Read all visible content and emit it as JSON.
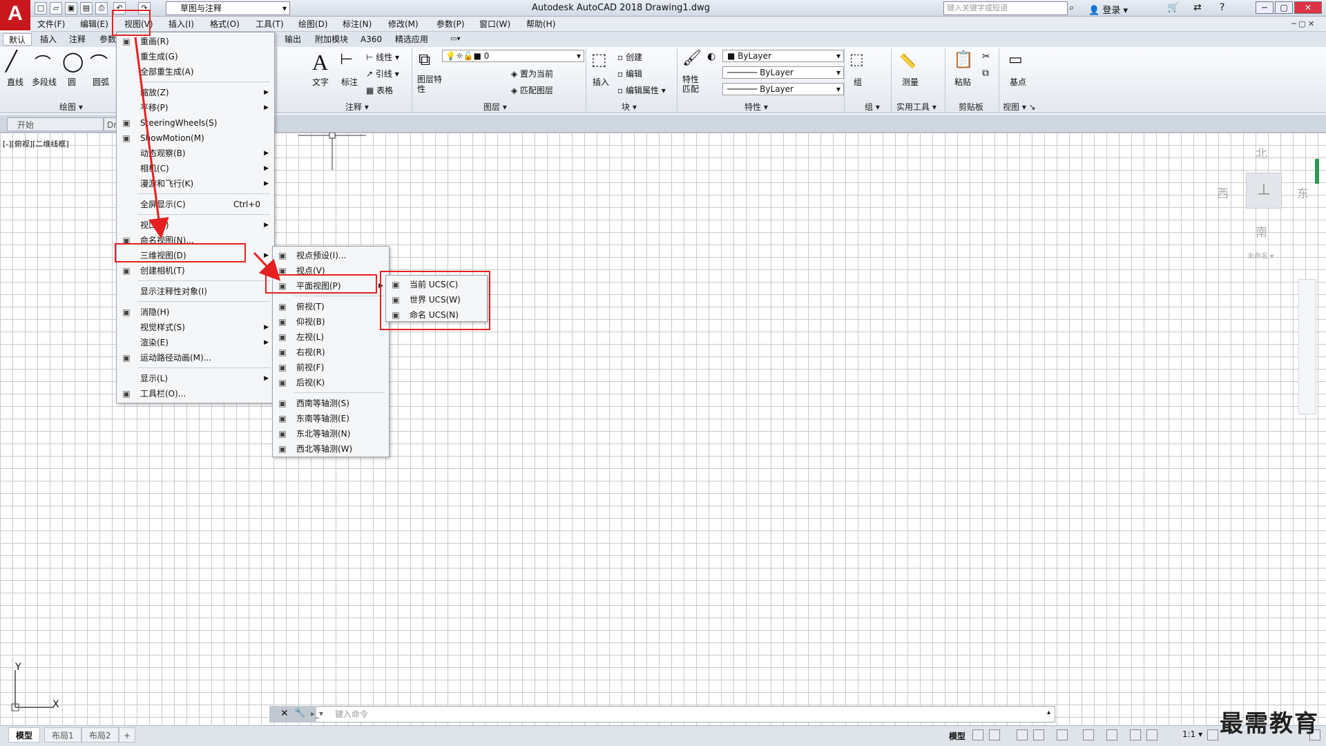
{
  "app_title": "Autodesk AutoCAD 2018    Drawing1.dwg",
  "workspace": "草图与注释",
  "search_placeholder": "键入关键字或短语",
  "login": "登录",
  "menubar": [
    "文件(F)",
    "编辑(E)",
    "视图(V)",
    "插入(I)",
    "格式(O)",
    "工具(T)",
    "绘图(D)",
    "标注(N)",
    "修改(M)",
    "参数(P)",
    "窗口(W)",
    "帮助(H)"
  ],
  "ribbon_tabs": [
    "默认",
    "插入",
    "注释",
    "参数",
    "输出",
    "附加模块",
    "A360",
    "精选应用"
  ],
  "ribbon": {
    "draw_buttons": [
      "直线",
      "多段线",
      "圆",
      "圆弧"
    ],
    "draw_panel": "绘图",
    "annot_buttons": [
      "文字",
      "标注"
    ],
    "annot_small": [
      "线性",
      "引线",
      "表格"
    ],
    "annot_panel": "注释",
    "layer_btn": "图层特性",
    "layer_value": "0",
    "layer_small": [
      "置为当前",
      "匹配图层"
    ],
    "layer_panel": "图层",
    "block_btn": "插入",
    "block_small": [
      "创建",
      "编辑",
      "编辑属性"
    ],
    "block_panel": "块",
    "prop_btn": "特性匹配",
    "prop_values": [
      "ByLayer",
      "ByLayer",
      "ByLayer"
    ],
    "prop_panel": "特性",
    "group_btn": "组",
    "group_panel": "组",
    "util_btn": "测量",
    "util_panel": "实用工具",
    "clip_btn": "粘贴",
    "clip_panel": "剪贴板",
    "view_btn": "基点",
    "view_panel": "视图"
  },
  "doc_tabs": [
    "开始",
    "Dr"
  ],
  "viewport_label": "[-][俯视][二维线框]",
  "viewcube": {
    "north": "北",
    "south": "南",
    "east": "东",
    "west": "西",
    "ucs": "未命名"
  },
  "view_menu": [
    {
      "label": "重画(R)",
      "icon": "redraw-icon"
    },
    {
      "label": "重生成(G)",
      "icon": ""
    },
    {
      "label": "全部重生成(A)",
      "icon": ""
    },
    {
      "label": "缩放(Z)",
      "icon": "",
      "arrow": true
    },
    {
      "label": "平移(P)",
      "icon": "",
      "arrow": true
    },
    {
      "label": "SteeringWheels(S)",
      "icon": "wheel-icon"
    },
    {
      "label": "ShowMotion(M)",
      "icon": "showmotion-icon"
    },
    {
      "label": "动态观察(B)",
      "icon": "",
      "arrow": true
    },
    {
      "label": "相机(C)",
      "icon": "",
      "arrow": true
    },
    {
      "label": "漫游和飞行(K)",
      "icon": "",
      "arrow": true
    },
    {
      "label": "全屏显示(C)",
      "icon": "",
      "shortcut": "Ctrl+0"
    },
    {
      "label": "视口(V)",
      "icon": "",
      "arrow": true
    },
    {
      "label": "命名视图(N)...",
      "icon": "named-view-icon"
    },
    {
      "label": "三维视图(D)",
      "icon": "",
      "arrow": true
    },
    {
      "label": "创建相机(T)",
      "icon": "camera-icon"
    },
    {
      "label": "显示注释性对象(I)",
      "icon": ""
    },
    {
      "label": "消隐(H)",
      "icon": "hide-icon"
    },
    {
      "label": "视觉样式(S)",
      "icon": "",
      "arrow": true
    },
    {
      "label": "渲染(E)",
      "icon": "",
      "arrow": true
    },
    {
      "label": "运动路径动画(M)...",
      "icon": "motion-path-icon"
    },
    {
      "label": "显示(L)",
      "icon": "",
      "arrow": true
    },
    {
      "label": "工具栏(O)...",
      "icon": "toolbar-icon"
    }
  ],
  "view3d_menu": [
    {
      "label": "视点预设(I)..."
    },
    {
      "label": "视点(V)"
    },
    {
      "label": "平面视图(P)",
      "arrow": true
    },
    {
      "label": "俯视(T)"
    },
    {
      "label": "仰视(B)"
    },
    {
      "label": "左视(L)"
    },
    {
      "label": "右视(R)"
    },
    {
      "label": "前视(F)"
    },
    {
      "label": "后视(K)"
    },
    {
      "label": "西南等轴测(S)"
    },
    {
      "label": "东南等轴测(E)"
    },
    {
      "label": "东北等轴测(N)"
    },
    {
      "label": "西北等轴测(W)"
    }
  ],
  "plan_menu": [
    {
      "label": "当前 UCS(C)"
    },
    {
      "label": "世界 UCS(W)"
    },
    {
      "label": "命名 UCS(N)"
    }
  ],
  "command_placeholder": "键入命令",
  "layout_tabs": [
    "模型",
    "布局1",
    "布局2"
  ],
  "status_model": "模型",
  "status_scale": "1:1",
  "watermark": "最需教育",
  "axis_x": "X",
  "axis_y": "Y"
}
